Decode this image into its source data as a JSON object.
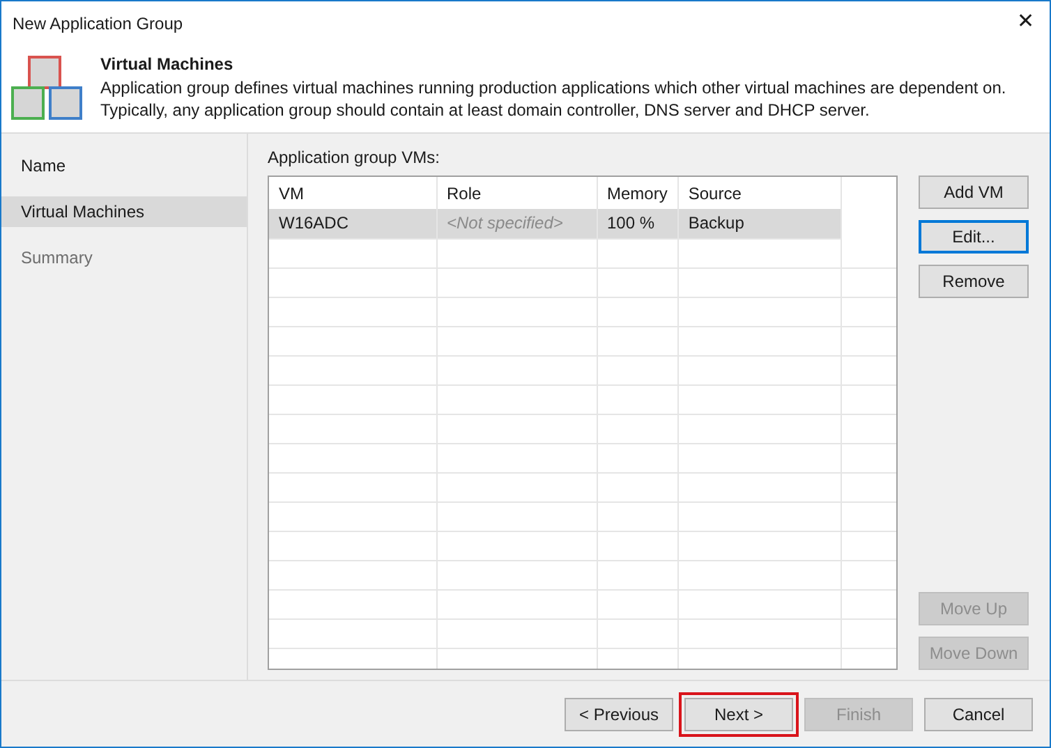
{
  "window": {
    "title": "New Application Group",
    "close": "✕"
  },
  "header": {
    "title": "Virtual Machines",
    "description": "Application group defines virtual machines running production applications which other virtual machines are dependent on. Typically, any application group should contain at least domain controller, DNS server and DHCP server."
  },
  "steps": [
    {
      "label": "Name",
      "selected": false
    },
    {
      "label": "Virtual Machines",
      "selected": true
    },
    {
      "label": "Summary",
      "selected": false
    }
  ],
  "table": {
    "label": "Application group VMs:",
    "columns": [
      "VM",
      "Role",
      "Memory",
      "Source"
    ],
    "rows": [
      {
        "cells": [
          "W16ADC",
          "<Not specified>",
          "100 %",
          "Backup"
        ],
        "selected": true,
        "role_placeholder": true
      }
    ]
  },
  "side_buttons": [
    {
      "label": "Add VM",
      "disabled": false,
      "focused": false
    },
    {
      "label": "Edit...",
      "disabled": false,
      "focused": true
    },
    {
      "label": "Remove",
      "disabled": false,
      "focused": false
    }
  ],
  "order_buttons": [
    {
      "label": "Move Up",
      "disabled": true
    },
    {
      "label": "Move Down",
      "disabled": true
    }
  ],
  "footer_buttons": [
    {
      "label": "< Previous",
      "disabled": false,
      "highlighted": false
    },
    {
      "label": "Next >",
      "disabled": false,
      "highlighted": true
    },
    {
      "label": "Finish",
      "disabled": true,
      "highlighted": false
    },
    {
      "label": "Cancel",
      "disabled": false,
      "highlighted": false
    }
  ]
}
